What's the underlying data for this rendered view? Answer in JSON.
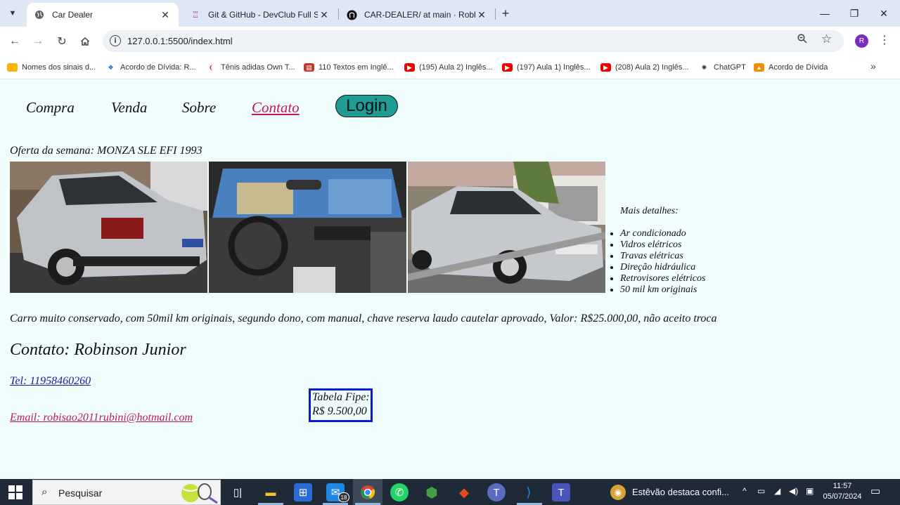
{
  "browser": {
    "tabs": [
      {
        "title": "Car Dealer"
      },
      {
        "title": "Git & GitHub - DevClub Full Sta"
      },
      {
        "title": "CAR-DEALER/ at main · Robbie"
      }
    ],
    "url": "127.0.0.1:5500/index.html",
    "profile_initial": "R",
    "bookmarks": [
      "Nomes dos sinais d...",
      "Acordo de Dívida: R...",
      "Tênis adidas Own T...",
      "110 Textos em Inglê...",
      "(195) Aula 2) Inglês...",
      "(197) Aula 1) Inglês...",
      "(208) Aula 2) Inglês...",
      "ChatGPT",
      "Acordo de Dívida"
    ]
  },
  "nav": {
    "compra": "Compra",
    "venda": "Venda",
    "sobre": "Sobre",
    "contato": "Contato",
    "login": "Login"
  },
  "offer": {
    "title": "Oferta da semana: MONZA SLE EFI 1993",
    "details_title": "Mais detalhes:",
    "details": [
      "Ar condicionado",
      "Vidros elétricos",
      "Travas elétricas",
      "Direção hidráulica",
      "Retrovisores elétricos",
      "50 mil km originais"
    ],
    "description": "Carro muito conservado, com 50mil km originais, segundo dono, com manual, chave reserva laudo cautelar aprovado, Valor: R$25.000,00, não aceito troca"
  },
  "contact": {
    "title": "Contato: Robinson Junior",
    "tel": "Tel: 11958460260",
    "email": "Email: robisao2011rubini@hotmail.com"
  },
  "fipe": {
    "line1": "Tabela Fipe:",
    "line2": "R$ 9.500,00"
  },
  "taskbar": {
    "search_placeholder": "Pesquisar",
    "mail_badge": "18",
    "news": "Estêvão destaca confi...",
    "time": "11:57",
    "date": "05/07/2024"
  },
  "colors": {
    "page_bg": "#f0fdfd",
    "login_bg": "#1f9c94",
    "contato_link": "#c2185b",
    "tel_link": "#1a1aa6",
    "fipe_border": "#0a1ad6"
  }
}
